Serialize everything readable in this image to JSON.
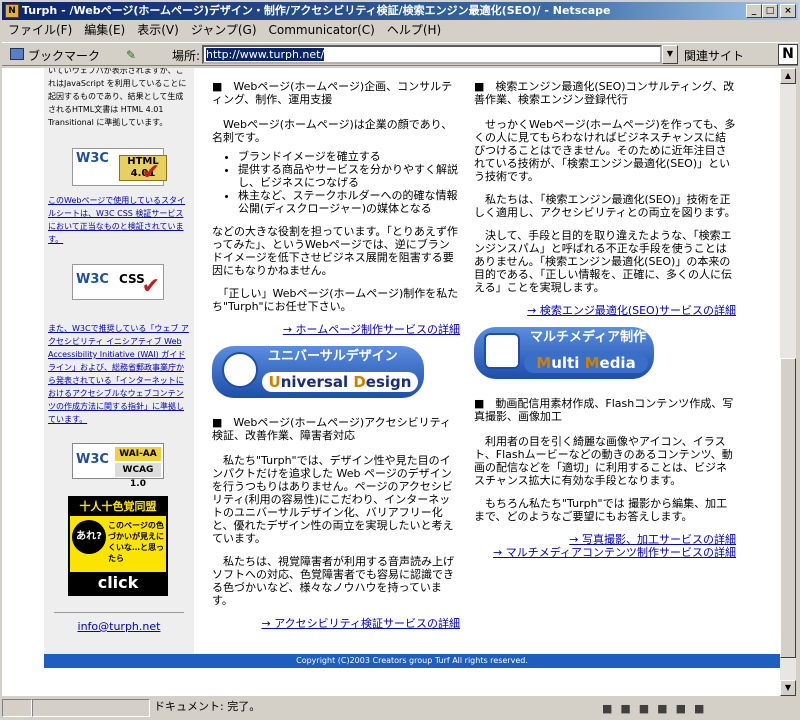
{
  "window": {
    "title": "Turph - /Webページ(ホームページ)デザイン・制作/アクセシビリティ検証/検索エンジン最適化(SEO)/ - Netscape"
  },
  "menu": [
    "ファイル(F)",
    "編集(E)",
    "表示(V)",
    "ジャンプ(G)",
    "Communicator(C)",
    "ヘルプ(H)"
  ],
  "locbar": {
    "bookmarks": "ブックマーク",
    "location_label": "場所:",
    "url": "http://www.turph.net/",
    "related": "関連サイト"
  },
  "status": {
    "text": "ドキュメント: 完了。"
  },
  "left": {
    "intro": "いていウェブパが表示されますが、これはJavaScript を利用していることに起因するものであり、結果として生成されるHTML文書は HTML 4.01 Transitional に準拠しています。",
    "badge_html": "HTML 4.01",
    "note_css": "このWebページで使用しているスタイルシートは、W3C CSS 検証サービスにおいて正当なものと検証されています。",
    "badge_css": "CSS",
    "note_wai": "また、W3Cで推奨している「ウェブ アクセシビリティ イニシアティブ Web Accessibility Initiative (WAI) ガイドライン」および、総務省郵政事業庁から発表されている「インターネットにおけるアクセシブルなウェブコンテンツの作成方法に関する指針」に準拠しています。",
    "badge_wai": "WAI-AA",
    "badge_wcag": "WCAG 1.0",
    "cud_title": "十人十色覚同盟",
    "cud_circle": "あれ?",
    "cud_msg": "このページの色づかいが見えにくいな…と思ったら",
    "cud_click": "click",
    "email": "info@turph.net"
  },
  "mid": {
    "h1": "■　Webページ(ホームページ)企画、コンサルティング、制作、運用支援",
    "p1": "　Webページ(ホームページ)は企業の顔であり、名刺です。",
    "li": [
      "ブランドイメージを確立する",
      "提供する商品やサービスを分かりやすく解説し、ビジネスにつなげる",
      "株主など、ステークホルダーへの的確な情報公開(ディスクロージャー)の媒体となる"
    ],
    "p2": "などの大きな役割を担っています。「とりあえず作ってみた」、というWebページでは、逆にブランドイメージを低下させビジネス展開を阻害する要因にもなりかねません。",
    "p3": "　「正しい」Webページ(ホームページ)制作を私たち\"Turph\"にお任せ下さい。",
    "link1": "→ ホームページ制作サービスの詳細",
    "banner_jp": "ユニバーサルデザイン",
    "banner_en_a": "U",
    "banner_en_b": "niversal ",
    "banner_en_c": "D",
    "banner_en_d": "esign",
    "h2": "■　Webページ(ホームページ)アクセシビリティ検証、改善作業、障害者対応",
    "p4": "　私たち\"Turph\"では、デザイン性や見た目のインパクトだけを追求した Web ページのデザインを行うつもりはありません。ページのアクセシビリティ(利用の容易性)にこだわり、インターネットのユニバーサルデザイン化、バリアフリー化と、優れたデザイン性の両立を実現したいと考えています。",
    "p5": "　私たちは、視覚障害者が利用する音声読み上げソフトへの対応、色覚障害者でも容易に認識できる色づかいなど、様々なノウハウを持っています。",
    "link2": "→ アクセシビリティ検証サービスの詳細"
  },
  "right": {
    "h1": "■　検索エンジン最適化(SEO)コンサルティング、改善作業、検索エンジン登録代行",
    "p1": "　せっかくWebページ(ホームページ)を作っても、多くの人に見てもらわなければビジネスチャンスに結びつけることはできません。そのために近年注目されている技術が、「検索エンジン最適化(SEO)」という技術です。",
    "p2": "　私たちは、「検索エンジン最適化(SEO)」技術を正しく適用し、アクセシビリティとの両立を図ります。",
    "p3": "　決して、手段と目的を取り違えたような、「検索エンジンスパム」と呼ばれる不正な手段を使うことはありません。「検索エンジン最適化(SEO)」の本来の目的である、「正しい情報を、正確に、多くの人に伝える」ことを実現します。",
    "link1": "→ 検索エンジ最適化(SEO)サービスの詳細",
    "banner_jp": "マルチメディア制作",
    "banner_en_a": "M",
    "banner_en_b": "ulti ",
    "banner_en_c": "M",
    "banner_en_d": "edia",
    "h2": "■　動画配信用素材作成、Flashコンテンツ作成、写真撮影、画像加工",
    "p4": "　利用者の目を引く綺麗な画像やアイコン、イラスト、Flashムービーなどの動きのあるコンテンツ、動画の配信などを「適切」に利用することは、ビジネスチャンス拡大に有効な手段となります。",
    "p5": "　もちろん私たち\"Turph\"では 撮影から編集、加工まで、どのようなご要望にもお答えします。",
    "link2": "→ 写真撮影、加工サービスの詳細",
    "link3": "→ マルチメディアコンテンツ制作サービスの詳細"
  },
  "footer": "Copyright (C)2003 Creators group Turf All rights reserved."
}
